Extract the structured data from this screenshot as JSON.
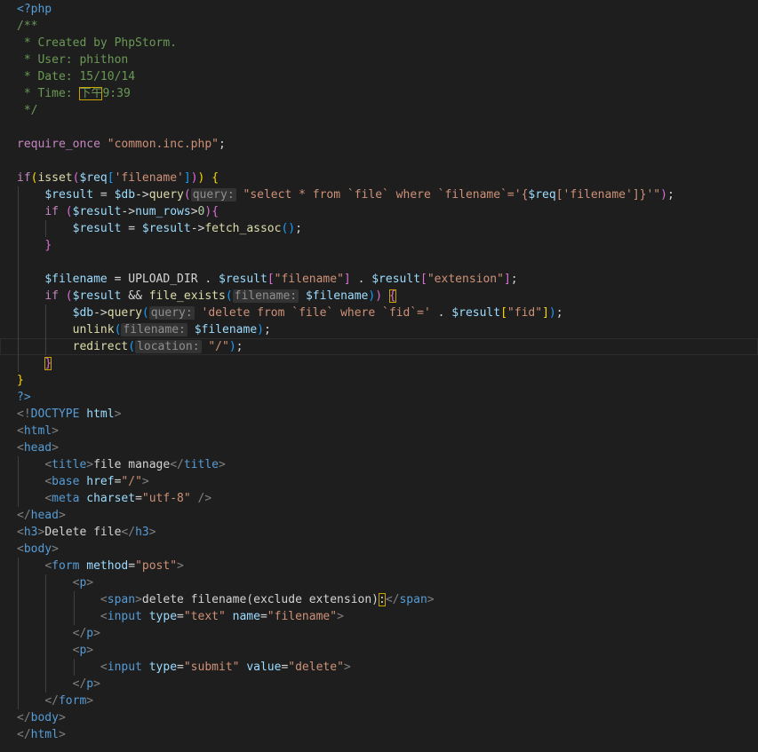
{
  "colors": {
    "background": "#1e1e1e",
    "keyword": "#569cd6",
    "control": "#c586c0",
    "function": "#dcdcaa",
    "variable": "#9cdcfe",
    "string": "#ce9178",
    "comment": "#6a9955",
    "number": "#b5cea8",
    "tag": "#569cd6",
    "attribute": "#9cdcfe",
    "bracket_gold": "#ffd700",
    "bracket_pink": "#da70d6",
    "bracket_blue": "#179fff",
    "punctuation": "#808080",
    "inlay_hint": "#8f8f8f"
  },
  "lines": [
    [
      [
        "<?php",
        "#569cd6"
      ]
    ],
    [
      [
        "/**",
        "#6a9955"
      ]
    ],
    [
      [
        " * Created by PhpStorm.",
        "#6a9955"
      ]
    ],
    [
      [
        " * User: phithon",
        "#6a9955"
      ]
    ],
    [
      [
        " * Date: 15/10/14",
        "#6a9955"
      ]
    ],
    [
      [
        " * Time: ",
        "#6a9955"
      ],
      [
        "下午",
        "#6a9955",
        "hl"
      ],
      [
        "9:39",
        "#6a9955"
      ]
    ],
    [
      [
        " */",
        "#6a9955"
      ]
    ],
    [],
    [
      [
        "require_once",
        "#c586c0"
      ],
      [
        " ",
        "#d4d4d4"
      ],
      [
        "\"common.inc.php\"",
        "#ce9178"
      ],
      [
        ";",
        "#d4d4d4"
      ]
    ],
    [],
    [
      [
        "if",
        "#c586c0"
      ],
      [
        "(",
        "#ffd700"
      ],
      [
        "isset",
        "#dcdcaa"
      ],
      [
        "(",
        "#da70d6"
      ],
      [
        "$req",
        "#9cdcfe"
      ],
      [
        "[",
        "#179fff"
      ],
      [
        "'filename'",
        "#ce9178"
      ],
      [
        "]",
        "#179fff"
      ],
      [
        ")",
        "#da70d6"
      ],
      [
        ")",
        "#ffd700"
      ],
      [
        " ",
        "#d4d4d4"
      ],
      [
        "{",
        "#ffd700"
      ]
    ],
    [
      [
        "    ",
        "#d4d4d4"
      ],
      [
        "$result",
        "#9cdcfe"
      ],
      [
        " = ",
        "#d4d4d4"
      ],
      [
        "$db",
        "#9cdcfe"
      ],
      [
        "->",
        "#d4d4d4"
      ],
      [
        "query",
        "#dcdcaa"
      ],
      [
        "(",
        "#da70d6"
      ],
      [
        "query:",
        "#8f8f8f",
        "hint"
      ],
      [
        " ",
        "#d4d4d4"
      ],
      [
        "\"select * from `file` where `filename`='{",
        "#ce9178"
      ],
      [
        "$req",
        "#9cdcfe"
      ],
      [
        "[",
        "#ce9178"
      ],
      [
        "'filename'",
        "#ce9178"
      ],
      [
        "]",
        "#ce9178"
      ],
      [
        "}'\"",
        "#ce9178"
      ],
      [
        ")",
        "#da70d6"
      ],
      [
        ";",
        "#d4d4d4"
      ]
    ],
    [
      [
        "    ",
        "#d4d4d4"
      ],
      [
        "if",
        "#c586c0"
      ],
      [
        " ",
        "#d4d4d4"
      ],
      [
        "(",
        "#da70d6"
      ],
      [
        "$result",
        "#9cdcfe"
      ],
      [
        "->",
        "#d4d4d4"
      ],
      [
        "num_rows",
        "#9cdcfe"
      ],
      [
        ">",
        "#d4d4d4"
      ],
      [
        "0",
        "#b5cea8"
      ],
      [
        ")",
        "#da70d6"
      ],
      [
        "{",
        "#da70d6"
      ]
    ],
    [
      [
        "        ",
        "#d4d4d4"
      ],
      [
        "$result",
        "#9cdcfe"
      ],
      [
        " = ",
        "#d4d4d4"
      ],
      [
        "$result",
        "#9cdcfe"
      ],
      [
        "->",
        "#d4d4d4"
      ],
      [
        "fetch_assoc",
        "#dcdcaa"
      ],
      [
        "(",
        "#179fff"
      ],
      [
        ")",
        "#179fff"
      ],
      [
        ";",
        "#d4d4d4"
      ]
    ],
    [
      [
        "    ",
        "#d4d4d4"
      ],
      [
        "}",
        "#da70d6"
      ]
    ],
    [],
    [
      [
        "    ",
        "#d4d4d4"
      ],
      [
        "$filename",
        "#9cdcfe"
      ],
      [
        " = ",
        "#d4d4d4"
      ],
      [
        "UPLOAD_DIR",
        "#d4d4d4"
      ],
      [
        " . ",
        "#d4d4d4"
      ],
      [
        "$result",
        "#9cdcfe"
      ],
      [
        "[",
        "#da70d6"
      ],
      [
        "\"filename\"",
        "#ce9178"
      ],
      [
        "]",
        "#da70d6"
      ],
      [
        " . ",
        "#d4d4d4"
      ],
      [
        "$result",
        "#9cdcfe"
      ],
      [
        "[",
        "#da70d6"
      ],
      [
        "\"extension\"",
        "#ce9178"
      ],
      [
        "]",
        "#da70d6"
      ],
      [
        ";",
        "#d4d4d4"
      ]
    ],
    [
      [
        "    ",
        "#d4d4d4"
      ],
      [
        "if",
        "#c586c0"
      ],
      [
        " ",
        "#d4d4d4"
      ],
      [
        "(",
        "#da70d6"
      ],
      [
        "$result",
        "#9cdcfe"
      ],
      [
        " && ",
        "#d4d4d4"
      ],
      [
        "file_exists",
        "#dcdcaa"
      ],
      [
        "(",
        "#179fff"
      ],
      [
        "filename:",
        "#8f8f8f",
        "hint"
      ],
      [
        " ",
        "#d4d4d4"
      ],
      [
        "$filename",
        "#9cdcfe"
      ],
      [
        ")",
        "#179fff"
      ],
      [
        ")",
        "#da70d6"
      ],
      [
        " ",
        "#d4d4d4"
      ],
      [
        "{",
        "#da70d6",
        "hl"
      ]
    ],
    [
      [
        "        ",
        "#d4d4d4"
      ],
      [
        "$db",
        "#9cdcfe"
      ],
      [
        "->",
        "#d4d4d4"
      ],
      [
        "query",
        "#dcdcaa"
      ],
      [
        "(",
        "#179fff"
      ],
      [
        "query:",
        "#8f8f8f",
        "hint"
      ],
      [
        " ",
        "#d4d4d4"
      ],
      [
        "'delete from `file` where `fid`='",
        "#ce9178"
      ],
      [
        " . ",
        "#d4d4d4"
      ],
      [
        "$result",
        "#9cdcfe"
      ],
      [
        "[",
        "#ffd700"
      ],
      [
        "\"fid\"",
        "#ce9178"
      ],
      [
        "]",
        "#ffd700"
      ],
      [
        ")",
        "#179fff"
      ],
      [
        ";",
        "#d4d4d4"
      ]
    ],
    [
      [
        "        ",
        "#d4d4d4"
      ],
      [
        "unlink",
        "#dcdcaa"
      ],
      [
        "(",
        "#179fff"
      ],
      [
        "filename:",
        "#8f8f8f",
        "hint"
      ],
      [
        " ",
        "#d4d4d4"
      ],
      [
        "$filename",
        "#9cdcfe"
      ],
      [
        ")",
        "#179fff"
      ],
      [
        ";",
        "#d4d4d4"
      ]
    ],
    [
      [
        "        ",
        "#d4d4d4"
      ],
      [
        "redirect",
        "#dcdcaa"
      ],
      [
        "(",
        "#179fff"
      ],
      [
        "location:",
        "#8f8f8f",
        "hint"
      ],
      [
        " ",
        "#d4d4d4"
      ],
      [
        "\"/\"",
        "#ce9178"
      ],
      [
        ")",
        "#179fff"
      ],
      [
        ";",
        "#d4d4d4"
      ]
    ],
    [
      [
        "    ",
        "#d4d4d4"
      ],
      [
        "}",
        "#da70d6",
        "hl"
      ]
    ],
    [
      [
        "}",
        "#ffd700"
      ]
    ],
    [
      [
        "?>",
        "#569cd6"
      ]
    ],
    [
      [
        "<!",
        "#808080"
      ],
      [
        "DOCTYPE",
        "#569cd6"
      ],
      [
        " ",
        "#d4d4d4"
      ],
      [
        "html",
        "#9cdcfe"
      ],
      [
        ">",
        "#808080"
      ]
    ],
    [
      [
        "<",
        "#808080"
      ],
      [
        "html",
        "#569cd6"
      ],
      [
        ">",
        "#808080"
      ]
    ],
    [
      [
        "<",
        "#808080"
      ],
      [
        "head",
        "#569cd6"
      ],
      [
        ">",
        "#808080"
      ]
    ],
    [
      [
        "    ",
        "#d4d4d4"
      ],
      [
        "<",
        "#808080"
      ],
      [
        "title",
        "#569cd6"
      ],
      [
        ">",
        "#808080"
      ],
      [
        "file manage",
        "#d4d4d4"
      ],
      [
        "</",
        "#808080"
      ],
      [
        "title",
        "#569cd6"
      ],
      [
        ">",
        "#808080"
      ]
    ],
    [
      [
        "    ",
        "#d4d4d4"
      ],
      [
        "<",
        "#808080"
      ],
      [
        "base",
        "#569cd6"
      ],
      [
        " ",
        "#d4d4d4"
      ],
      [
        "href",
        "#9cdcfe"
      ],
      [
        "=",
        "#d4d4d4"
      ],
      [
        "\"/\"",
        "#ce9178"
      ],
      [
        ">",
        "#808080"
      ]
    ],
    [
      [
        "    ",
        "#d4d4d4"
      ],
      [
        "<",
        "#808080"
      ],
      [
        "meta",
        "#569cd6"
      ],
      [
        " ",
        "#d4d4d4"
      ],
      [
        "charset",
        "#9cdcfe"
      ],
      [
        "=",
        "#d4d4d4"
      ],
      [
        "\"utf-8\"",
        "#ce9178"
      ],
      [
        " ",
        "#d4d4d4"
      ],
      [
        "/>",
        "#808080"
      ]
    ],
    [
      [
        "</",
        "#808080"
      ],
      [
        "head",
        "#569cd6"
      ],
      [
        ">",
        "#808080"
      ]
    ],
    [
      [
        "<",
        "#808080"
      ],
      [
        "h3",
        "#569cd6"
      ],
      [
        ">",
        "#808080"
      ],
      [
        "Delete file",
        "#d4d4d4"
      ],
      [
        "</",
        "#808080"
      ],
      [
        "h3",
        "#569cd6"
      ],
      [
        ">",
        "#808080"
      ]
    ],
    [
      [
        "<",
        "#808080"
      ],
      [
        "body",
        "#569cd6"
      ],
      [
        ">",
        "#808080"
      ]
    ],
    [
      [
        "    ",
        "#d4d4d4"
      ],
      [
        "<",
        "#808080"
      ],
      [
        "form",
        "#569cd6"
      ],
      [
        " ",
        "#d4d4d4"
      ],
      [
        "method",
        "#9cdcfe"
      ],
      [
        "=",
        "#d4d4d4"
      ],
      [
        "\"post\"",
        "#ce9178"
      ],
      [
        ">",
        "#808080"
      ]
    ],
    [
      [
        "        ",
        "#d4d4d4"
      ],
      [
        "<",
        "#808080"
      ],
      [
        "p",
        "#569cd6"
      ],
      [
        ">",
        "#808080"
      ]
    ],
    [
      [
        "            ",
        "#d4d4d4"
      ],
      [
        "<",
        "#808080"
      ],
      [
        "span",
        "#569cd6"
      ],
      [
        ">",
        "#808080"
      ],
      [
        "delete filename(exclude extension)",
        "#d4d4d4"
      ],
      [
        ":",
        "#d4d4d4",
        "hl"
      ],
      [
        "</",
        "#808080"
      ],
      [
        "span",
        "#569cd6"
      ],
      [
        ">",
        "#808080"
      ]
    ],
    [
      [
        "            ",
        "#d4d4d4"
      ],
      [
        "<",
        "#808080"
      ],
      [
        "input",
        "#569cd6"
      ],
      [
        " ",
        "#d4d4d4"
      ],
      [
        "type",
        "#9cdcfe"
      ],
      [
        "=",
        "#d4d4d4"
      ],
      [
        "\"text\"",
        "#ce9178"
      ],
      [
        " ",
        "#d4d4d4"
      ],
      [
        "name",
        "#9cdcfe"
      ],
      [
        "=",
        "#d4d4d4"
      ],
      [
        "\"filename\"",
        "#ce9178"
      ],
      [
        ">",
        "#808080"
      ]
    ],
    [
      [
        "        ",
        "#d4d4d4"
      ],
      [
        "</",
        "#808080"
      ],
      [
        "p",
        "#569cd6"
      ],
      [
        ">",
        "#808080"
      ]
    ],
    [
      [
        "        ",
        "#d4d4d4"
      ],
      [
        "<",
        "#808080"
      ],
      [
        "p",
        "#569cd6"
      ],
      [
        ">",
        "#808080"
      ]
    ],
    [
      [
        "            ",
        "#d4d4d4"
      ],
      [
        "<",
        "#808080"
      ],
      [
        "input",
        "#569cd6"
      ],
      [
        " ",
        "#d4d4d4"
      ],
      [
        "type",
        "#9cdcfe"
      ],
      [
        "=",
        "#d4d4d4"
      ],
      [
        "\"submit\"",
        "#ce9178"
      ],
      [
        " ",
        "#d4d4d4"
      ],
      [
        "value",
        "#9cdcfe"
      ],
      [
        "=",
        "#d4d4d4"
      ],
      [
        "\"delete\"",
        "#ce9178"
      ],
      [
        ">",
        "#808080"
      ]
    ],
    [
      [
        "        ",
        "#d4d4d4"
      ],
      [
        "</",
        "#808080"
      ],
      [
        "p",
        "#569cd6"
      ],
      [
        ">",
        "#808080"
      ]
    ],
    [
      [
        "    ",
        "#d4d4d4"
      ],
      [
        "</",
        "#808080"
      ],
      [
        "form",
        "#569cd6"
      ],
      [
        ">",
        "#808080"
      ]
    ],
    [
      [
        "</",
        "#808080"
      ],
      [
        "body",
        "#569cd6"
      ],
      [
        ">",
        "#808080"
      ]
    ],
    [
      [
        "</",
        "#808080"
      ],
      [
        "html",
        "#569cd6"
      ],
      [
        ">",
        "#808080"
      ]
    ]
  ]
}
